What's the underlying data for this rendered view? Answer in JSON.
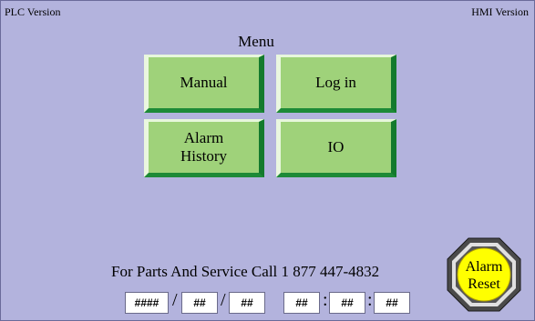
{
  "header": {
    "left_label": "PLC Version",
    "right_label": "HMI Version"
  },
  "menu": {
    "title": "Menu",
    "buttons": [
      {
        "id": "manual",
        "label": "Manual"
      },
      {
        "id": "login",
        "label": "Log in"
      },
      {
        "id": "alarm_history",
        "label": "Alarm\nHistory"
      },
      {
        "id": "io",
        "label": "IO"
      }
    ]
  },
  "footer": {
    "service_text": "For Parts And Service Call 1 877 447-4832",
    "date": {
      "year": "####",
      "month": "##",
      "day": "##",
      "separator": "/"
    },
    "time": {
      "hour": "##",
      "minute": "##",
      "second": "##",
      "separator": ":"
    }
  },
  "alarm_reset": {
    "line1": "Alarm",
    "line2": "Reset",
    "color": "#ffff00"
  },
  "colors": {
    "background": "#b3b3dd",
    "button_face": "#9fd27a",
    "button_shadow": "#137a2d"
  }
}
